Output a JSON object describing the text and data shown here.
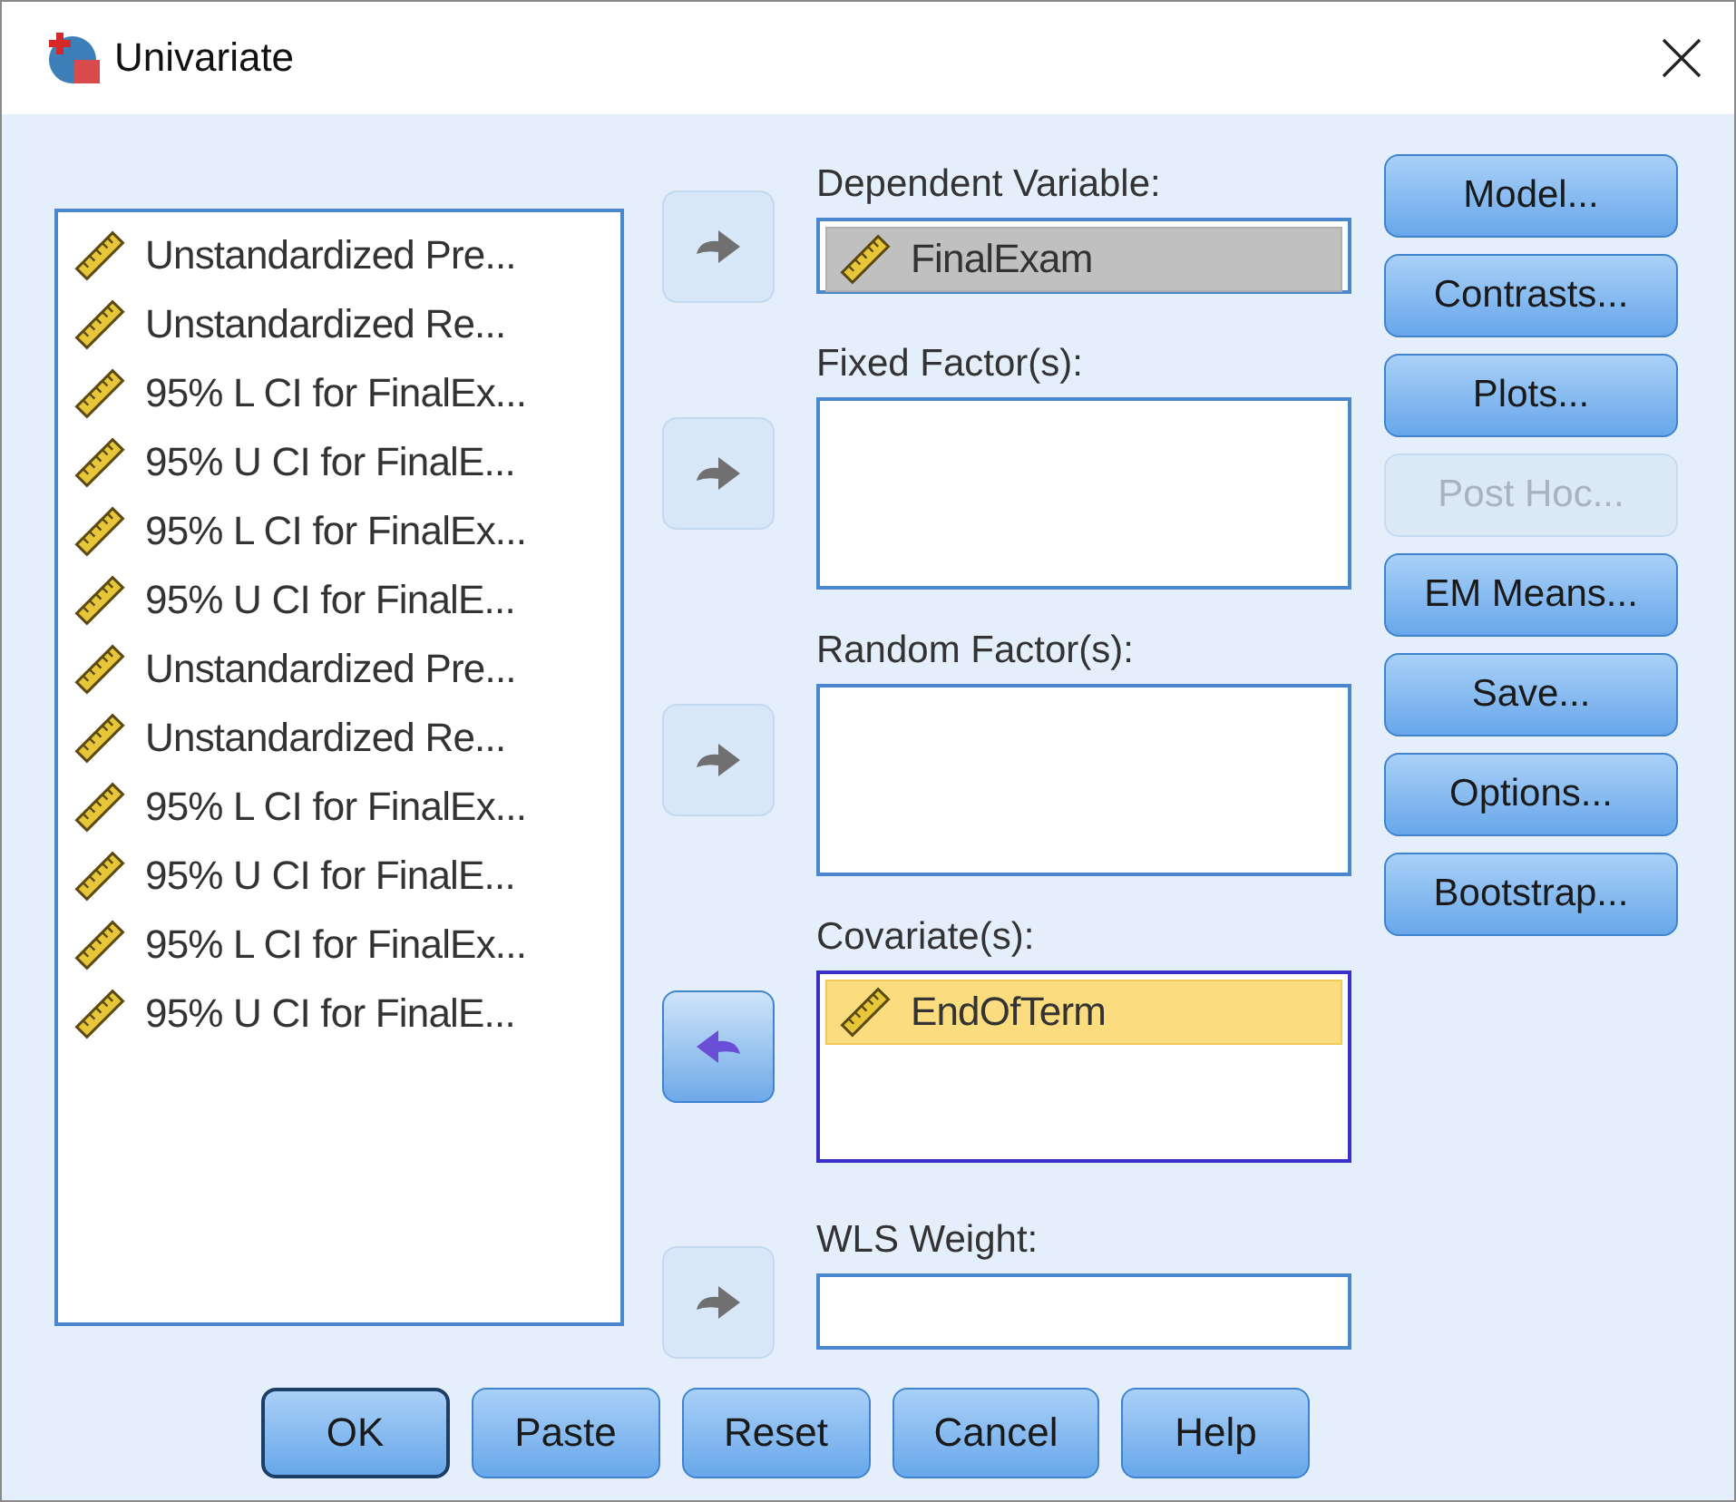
{
  "window": {
    "title": "Univariate"
  },
  "source_list": {
    "items": [
      {
        "label": "Unstandardized Pre..."
      },
      {
        "label": "Unstandardized Re..."
      },
      {
        "label": "95% L CI for FinalEx..."
      },
      {
        "label": "95% U CI for FinalE..."
      },
      {
        "label": "95% L CI for FinalEx..."
      },
      {
        "label": "95% U CI for FinalE..."
      },
      {
        "label": "Unstandardized Pre..."
      },
      {
        "label": "Unstandardized Re..."
      },
      {
        "label": "95% L CI for FinalEx..."
      },
      {
        "label": "95% U CI for FinalE..."
      },
      {
        "label": "95% L CI for FinalEx..."
      },
      {
        "label": "95% U CI for FinalE..."
      }
    ]
  },
  "targets": [
    {
      "label": "Dependent Variable:",
      "kind": "single",
      "focused": false,
      "arrow": {
        "reversed": false,
        "enabled": false
      },
      "items": [
        {
          "label": "FinalExam",
          "selected": false
        }
      ]
    },
    {
      "label": "Fixed Factor(s):",
      "kind": "tall",
      "focused": false,
      "arrow": {
        "reversed": false,
        "enabled": false
      }
    },
    {
      "label": "Random Factor(s):",
      "kind": "tall",
      "focused": false,
      "arrow": {
        "reversed": false,
        "enabled": false
      }
    },
    {
      "label": "Covariate(s):",
      "kind": "tall",
      "focused": true,
      "arrow": {
        "reversed": true,
        "enabled": true
      },
      "items": [
        {
          "label": "EndOfTerm",
          "selected": true
        }
      ]
    },
    {
      "label": "WLS Weight:",
      "kind": "single",
      "focused": false,
      "arrow": {
        "reversed": false,
        "enabled": false
      }
    }
  ],
  "side_buttons": [
    {
      "label": "Model...",
      "disabled": false
    },
    {
      "label": "Contrasts...",
      "disabled": false
    },
    {
      "label": "Plots...",
      "disabled": false
    },
    {
      "label": "Post Hoc...",
      "disabled": true
    },
    {
      "label": "EM Means...",
      "disabled": false
    },
    {
      "label": "Save...",
      "disabled": false
    },
    {
      "label": "Options...",
      "disabled": false
    },
    {
      "label": "Bootstrap...",
      "disabled": false
    }
  ],
  "bottom_buttons": [
    {
      "label": "OK",
      "is_default": true
    },
    {
      "label": "Paste",
      "is_default": false
    },
    {
      "label": "Reset",
      "is_default": false
    },
    {
      "label": "Cancel",
      "is_default": false
    },
    {
      "label": "Help",
      "is_default": false
    }
  ]
}
